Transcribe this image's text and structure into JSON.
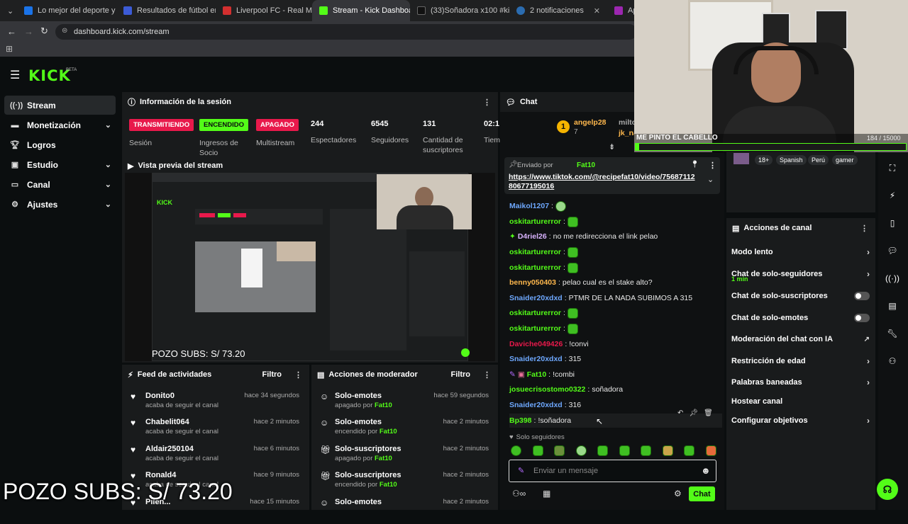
{
  "browser": {
    "tabs": [
      {
        "title": "Lo mejor del deporte y el",
        "color": "#1a73e8"
      },
      {
        "title": "Resultados de fútbol en d",
        "color": "#3c5bd6"
      },
      {
        "title": "Liverpool FC - Real Madri",
        "color": "#d32f2f"
      },
      {
        "title": "Stream - Kick Dashboard",
        "color": "#53fc18"
      },
      {
        "title": "(33)Soñadora x100 #kick",
        "color": "#111111"
      },
      {
        "title": "2 notificaciones",
        "color": "#2b6cb0"
      },
      {
        "title": "App",
        "color": "#9c27b0"
      }
    ],
    "url": "dashboard.kick.com/stream"
  },
  "brand": {
    "logo": "KICK",
    "beta": "BETA",
    "accent": "#53fc18"
  },
  "sidebar": {
    "items": [
      {
        "label": "Stream",
        "icon": "radio-icon"
      },
      {
        "label": "Monetización",
        "icon": "money-icon"
      },
      {
        "label": "Logros",
        "icon": "trophy-icon"
      },
      {
        "label": "Estudio",
        "icon": "studio-icon"
      },
      {
        "label": "Canal",
        "icon": "channel-icon"
      },
      {
        "label": "Ajustes",
        "icon": "gear-icon"
      }
    ]
  },
  "session": {
    "title": "Información de la sesión",
    "badges": [
      {
        "text": "TRANSMITIENDO",
        "label": "Sesión",
        "color": "#e8194b"
      },
      {
        "text": "ENCENDIDO",
        "label": "Ingresos de Socio",
        "color": "#53fc18"
      },
      {
        "text": "APAGADO",
        "label": "Multistream",
        "color": "#e8194b"
      }
    ],
    "stats": [
      {
        "value": "244",
        "label": "Espectadores"
      },
      {
        "value": "6545",
        "label": "Seguidores"
      },
      {
        "value": "131",
        "label": "Cantidad de suscriptores"
      },
      {
        "value": "02:1",
        "label": "Tiem"
      }
    ]
  },
  "preview": {
    "title": "Vista previa del stream",
    "overlay": "POZO SUBS: S/ 73.20"
  },
  "activity": {
    "title": "Feed de actividades",
    "filter": "Filtro",
    "items": [
      {
        "name": "Donito0",
        "sub": "acaba de seguir el canal",
        "time": "hace 34 segundos"
      },
      {
        "name": "Chabelit064",
        "sub": "acaba de seguir el canal",
        "time": "hace 2 minutos"
      },
      {
        "name": "Aldair250104",
        "sub": "acaba de seguir el canal",
        "time": "hace 6 minutos"
      },
      {
        "name": "Ronald4",
        "sub": "acaba de seguir el canal",
        "time": "hace 9 minutos"
      },
      {
        "name": "Pilen...",
        "sub": "",
        "time": "hace 15 minutos"
      }
    ]
  },
  "modactions": {
    "title": "Acciones de moderador",
    "filter": "Filtro",
    "items": [
      {
        "name": "Solo-emotes",
        "state": "apagado por",
        "by": "Fat10",
        "time": "hace 59 segundos",
        "icon": "smile-icon"
      },
      {
        "name": "Solo-emotes",
        "state": "encendido por",
        "by": "Fat10",
        "time": "hace 2 minutos",
        "icon": "smile-icon"
      },
      {
        "name": "Solo-suscriptores",
        "state": "apagado por",
        "by": "Fat10",
        "time": "hace 2 minutos",
        "icon": "gift-icon"
      },
      {
        "name": "Solo-suscriptores",
        "state": "encendido por",
        "by": "Fat10",
        "time": "hace 2 minutos",
        "icon": "gift-icon"
      },
      {
        "name": "Solo-emotes",
        "state": "",
        "by": "",
        "time": "hace 2 minutos",
        "icon": "smile-icon"
      }
    ]
  },
  "chat": {
    "title": "Chat",
    "top_user": "angelp28",
    "top_user2": "milto",
    "top_user3": "jk_na",
    "top_rank": "1",
    "top_count": "7",
    "pinned_by_label": "Enviado por",
    "pinned_by": "Fat10",
    "pinned_link": "https://www.tiktok.com/@recipefat10/video/7568711280677195016",
    "messages": [
      {
        "user": "Maikol1207",
        "text": "",
        "color": "#6ea8fe",
        "emote": true
      },
      {
        "user": "oskitarturerror",
        "text": "",
        "color": "#53fc18",
        "emote": true
      },
      {
        "user": "D4riel26",
        "text": "no me redirecciona el link pelao",
        "color": "#d9b3ff",
        "emote": false
      },
      {
        "user": "oskitarturerror",
        "text": "",
        "color": "#53fc18",
        "emote": true
      },
      {
        "user": "oskitarturerror",
        "text": "",
        "color": "#53fc18",
        "emote": true
      },
      {
        "user": "benny050403",
        "text": "pelao cual es el stake alto?",
        "color": "#ffb84d",
        "emote": false
      },
      {
        "user": "Snaider20xdxd",
        "text": "PTMR DE LA NADA SUBIMOS A 315",
        "color": "#6ea8fe",
        "emote": false
      },
      {
        "user": "oskitarturerror",
        "text": "",
        "color": "#53fc18",
        "emote": true
      },
      {
        "user": "oskitarturerror",
        "text": "",
        "color": "#53fc18",
        "emote": true
      },
      {
        "user": "Daviche049426",
        "text": "!convi",
        "color": "#e8194b",
        "emote": false
      },
      {
        "user": "Snaider20xdxd",
        "text": "315",
        "color": "#6ea8fe",
        "emote": false
      },
      {
        "user": "Fat10",
        "text": "!combi",
        "color": "#53fc18",
        "emote": false
      },
      {
        "user": "josuecrisostomo0322",
        "text": "soñadora",
        "color": "#53fc18",
        "emote": false
      },
      {
        "user": "Snaider20xdxd",
        "text": "316",
        "color": "#6ea8fe",
        "emote": false
      },
      {
        "user": "Bp398",
        "text": "!soñadora",
        "color": "#53fc18",
        "emote": false
      }
    ],
    "mode": "Solo seguidores",
    "placeholder": "Enviar un mensaje",
    "send": "Chat"
  },
  "webcam": {
    "overlay": "ME PINTO EL CABELLO",
    "goal": "184 / 15000",
    "tags": [
      "18+",
      "Spanish",
      "Perú",
      "gamer"
    ]
  },
  "channel_actions": {
    "title": "Acciones de canal",
    "items": [
      {
        "label": "Modo lento",
        "kind": "arrow",
        "sub": ""
      },
      {
        "label": "Chat de solo-seguidores",
        "kind": "arrow",
        "sub": "1 min"
      },
      {
        "label": "Chat de solo-suscriptores",
        "kind": "toggle",
        "sub": ""
      },
      {
        "label": "Chat de solo-emotes",
        "kind": "toggle",
        "sub": ""
      },
      {
        "label": "Moderación del chat con IA",
        "kind": "external",
        "sub": ""
      },
      {
        "label": "Restricción de edad",
        "kind": "arrow",
        "sub": ""
      },
      {
        "label": "Palabras baneadas",
        "kind": "arrow",
        "sub": ""
      },
      {
        "label": "Hostear canal",
        "kind": "none",
        "sub": ""
      },
      {
        "label": "Configurar objetivos",
        "kind": "arrow",
        "sub": ""
      }
    ]
  },
  "bottom_overlay": "POZO SUBS: S/ 73.20"
}
